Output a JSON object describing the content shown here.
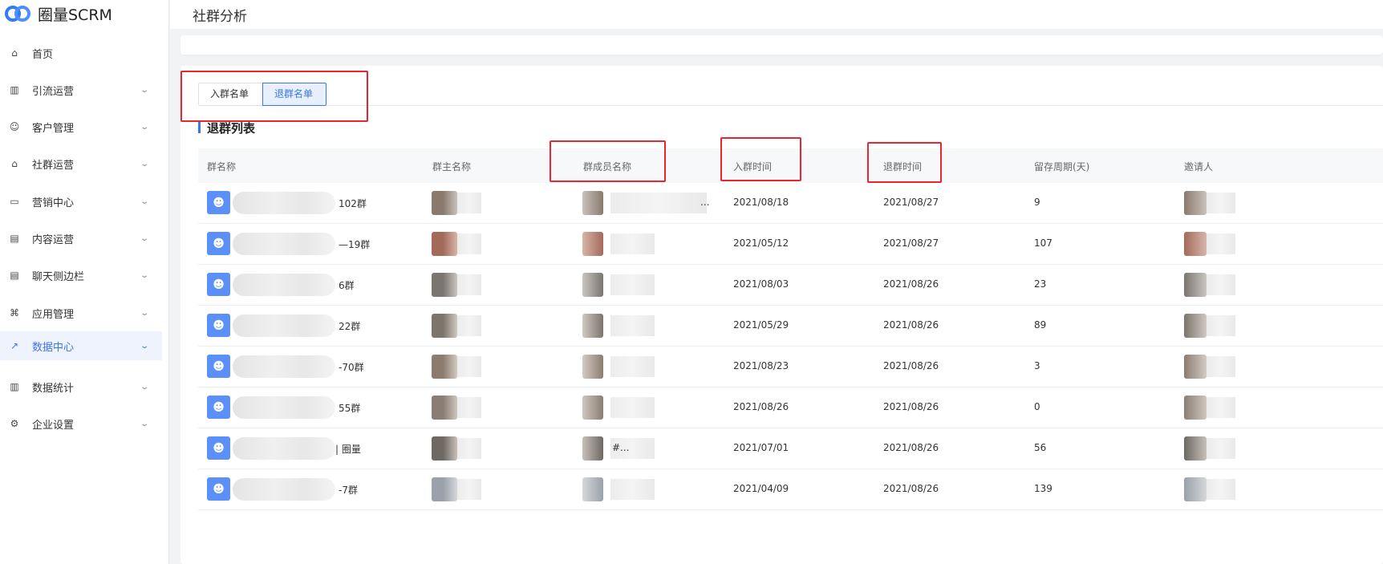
{
  "app": {
    "name": "圈量SCRM"
  },
  "sidebar": {
    "items": [
      {
        "label": "首页",
        "icon": "home-icon",
        "glyph": "⌂",
        "chevron": false,
        "active": false
      },
      {
        "label": "引流运营",
        "icon": "traffic-icon",
        "glyph": "▥",
        "chevron": true,
        "active": false
      },
      {
        "label": "客户管理",
        "icon": "customer-icon",
        "glyph": "☺",
        "chevron": true,
        "active": false
      },
      {
        "label": "社群运营",
        "icon": "community-icon",
        "glyph": "⌂",
        "chevron": true,
        "active": false
      },
      {
        "label": "营销中心",
        "icon": "marketing-icon",
        "glyph": "▭",
        "chevron": true,
        "active": false
      },
      {
        "label": "内容运营",
        "icon": "content-icon",
        "glyph": "▤",
        "chevron": true,
        "active": false
      },
      {
        "label": "聊天侧边栏",
        "icon": "chat-sidebar-icon",
        "glyph": "▤",
        "chevron": true,
        "active": false
      },
      {
        "label": "应用管理",
        "icon": "apps-icon",
        "glyph": "⌘",
        "chevron": true,
        "active": false
      },
      {
        "label": "数据中心",
        "icon": "data-center-icon",
        "glyph": "↗",
        "chevron": true,
        "active": true
      },
      {
        "label": "数据统计",
        "icon": "statistics-icon",
        "glyph": "▥",
        "chevron": true,
        "active": false
      },
      {
        "label": "企业设置",
        "icon": "settings-icon",
        "glyph": "⚙",
        "chevron": true,
        "active": false
      }
    ]
  },
  "header": {
    "title": "社群分析"
  },
  "tabs": {
    "join_list": "入群名单",
    "leave_list": "退群名单"
  },
  "section": {
    "title": "退群列表"
  },
  "table": {
    "columns": [
      "群名称",
      "群主名称",
      "群成员名称",
      "入群时间",
      "退群时间",
      "留存周期(天)",
      "邀请人"
    ],
    "rows": [
      {
        "group": "102群",
        "member": "...",
        "join": "2021/08/18",
        "leave": "2021/08/27",
        "days": "9"
      },
      {
        "group": "—19群",
        "member": "",
        "join": "2021/05/12",
        "leave": "2021/08/27",
        "days": "107"
      },
      {
        "group": "6群",
        "member": "",
        "join": "2021/08/03",
        "leave": "2021/08/26",
        "days": "23"
      },
      {
        "group": "22群",
        "member": "",
        "join": "2021/05/29",
        "leave": "2021/08/26",
        "days": "89"
      },
      {
        "group": "-70群",
        "member": "",
        "join": "2021/08/23",
        "leave": "2021/08/26",
        "days": "3"
      },
      {
        "group": "55群",
        "member": "",
        "join": "2021/08/26",
        "leave": "2021/08/26",
        "days": "0"
      },
      {
        "group": "| 圈量",
        "member": "#...",
        "join": "2021/07/01",
        "leave": "2021/08/26",
        "days": "56"
      },
      {
        "group": "-7群",
        "member": "",
        "join": "2021/04/09",
        "leave": "2021/08/26",
        "days": "139"
      }
    ]
  },
  "colors": {
    "accent": "#3a76ef",
    "annotation": "#e8262f",
    "group_icon": "#5b8ff9"
  }
}
